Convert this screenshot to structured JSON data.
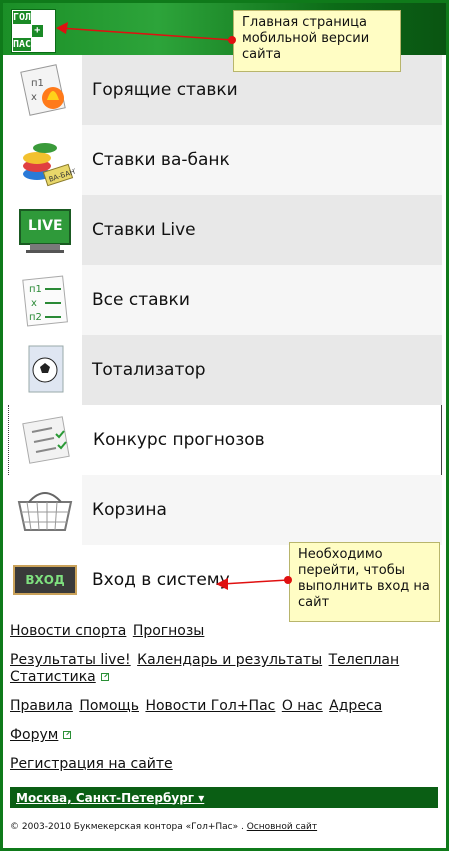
{
  "header": {
    "logo": {
      "cells": [
        "ГОЛ",
        "",
        "",
        "",
        "+",
        "",
        "ПАС",
        "",
        ""
      ],
      "alt": "ГОЛ+ПАС"
    }
  },
  "menu": [
    {
      "label": "Горящие ставки",
      "icon": "hot-bets-icon"
    },
    {
      "label": "Ставки ва-банк",
      "icon": "va-bank-chips-icon"
    },
    {
      "label": "Ставки Live",
      "icon": "live-monitor-icon"
    },
    {
      "label": "Все ставки",
      "icon": "all-bets-list-icon"
    },
    {
      "label": "Тотализатор",
      "icon": "totalizator-ball-icon"
    },
    {
      "label": "Конкурс прогнозов",
      "icon": "checklist-icon"
    },
    {
      "label": "Корзина",
      "icon": "basket-icon"
    },
    {
      "label": "Вход в систему",
      "icon": "login-icon",
      "icon_text": "ВХОД"
    }
  ],
  "links": {
    "row1": [
      "Новости спорта",
      "Прогнозы"
    ],
    "row2": [
      "Результаты live!",
      "Календарь и результаты",
      "Телеплан",
      "Статистика"
    ],
    "row3": [
      "Правила",
      "Помощь",
      "Новости Гол+Пас",
      "О нас",
      "Адреса"
    ],
    "row4": [
      "Форум"
    ],
    "row5": [
      "Регистрация на сайте"
    ]
  },
  "city": "Москва, Санкт-Петербург ▾",
  "footer": {
    "text": "© 2003-2010 Букмекерская контора «Гол+Пас» .",
    "link": "Основной сайт"
  },
  "callouts": {
    "top": "Главная страница мобильной версии сайта",
    "bottom": "Необходимо перейти, чтобы выполнить вход на сайт"
  },
  "colors": {
    "brand_green": "#1a8a26",
    "dark_green": "#0a5e14",
    "callout_bg": "#fffdc4",
    "arrow_red": "#e01010"
  }
}
